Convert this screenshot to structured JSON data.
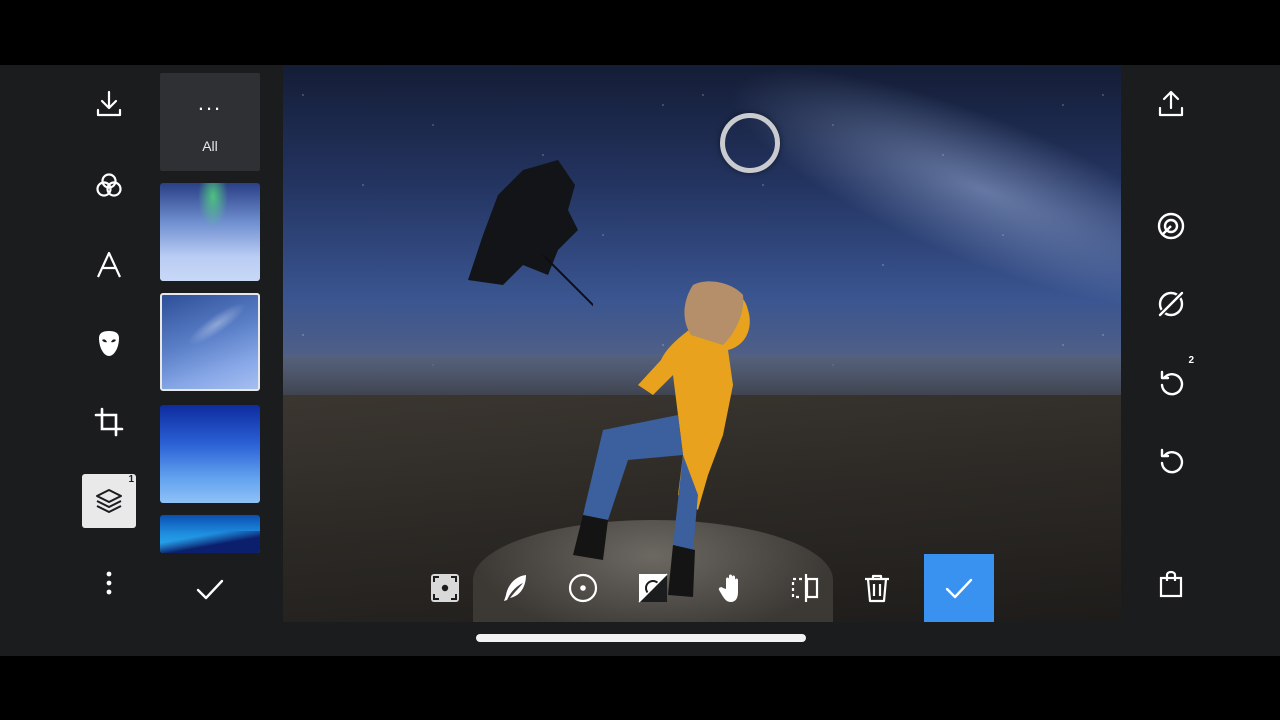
{
  "left_toolbar": {
    "items": [
      {
        "icon": "download-icon",
        "label": ""
      },
      {
        "icon": "effects-icon",
        "label": ""
      },
      {
        "icon": "text-icon",
        "glyph": "A"
      },
      {
        "icon": "mask-icon",
        "label": ""
      },
      {
        "icon": "crop-icon",
        "label": ""
      },
      {
        "icon": "layers-icon",
        "badge": "1"
      },
      {
        "icon": "more-vertical-icon",
        "label": ""
      }
    ]
  },
  "thumbnail_panel": {
    "all_tile": {
      "dots": "...",
      "label": "All"
    },
    "thumbnails": [
      {
        "name": "aurora-sky"
      },
      {
        "name": "milky-way-sky"
      },
      {
        "name": "blue-gradient-sky"
      },
      {
        "name": "cyan-sky"
      }
    ],
    "selected_index": 1
  },
  "canvas": {
    "subject": "person-with-umbrella-under-starry-sky"
  },
  "bottom_toolbar": {
    "tools": [
      "select-auto-icon",
      "feather-brush-icon",
      "radial-icon",
      "invert-icon",
      "hand-icon",
      "flip-icon",
      "trash-icon"
    ],
    "confirm": "checkmark-icon"
  },
  "right_toolbar": {
    "items": [
      {
        "icon": "share-icon"
      },
      {
        "icon": "overlay-icon"
      },
      {
        "icon": "eraser-off-icon"
      },
      {
        "icon": "redo-icon",
        "badge": "2"
      },
      {
        "icon": "undo-icon"
      },
      {
        "icon": "shopping-bag-icon"
      }
    ]
  },
  "colors": {
    "background": "#1b1c1e",
    "accent": "#3a92f0",
    "active_tool_bg": "#e9e9ea"
  }
}
